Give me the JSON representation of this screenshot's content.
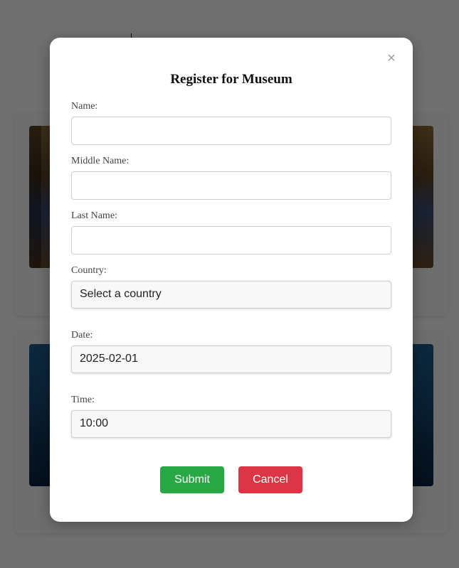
{
  "modal": {
    "title": "Register for Museum",
    "close_glyph": "×",
    "fields": {
      "name": {
        "label": "Name:",
        "value": ""
      },
      "middle_name": {
        "label": "Middle Name:",
        "value": ""
      },
      "last_name": {
        "label": "Last Name:",
        "value": ""
      },
      "country": {
        "label": "Country:",
        "value": "Select a country"
      },
      "date": {
        "label": "Date:",
        "value": "2025-02-01"
      },
      "time": {
        "label": "Time:",
        "value": "10:00"
      }
    },
    "buttons": {
      "submit_label": "Submit",
      "cancel_label": "Cancel"
    }
  },
  "colors": {
    "submit": "#28a745",
    "cancel": "#dc3545",
    "overlay": "rgba(0,0,0,0.56)"
  },
  "icons": {
    "close": "close-icon"
  }
}
